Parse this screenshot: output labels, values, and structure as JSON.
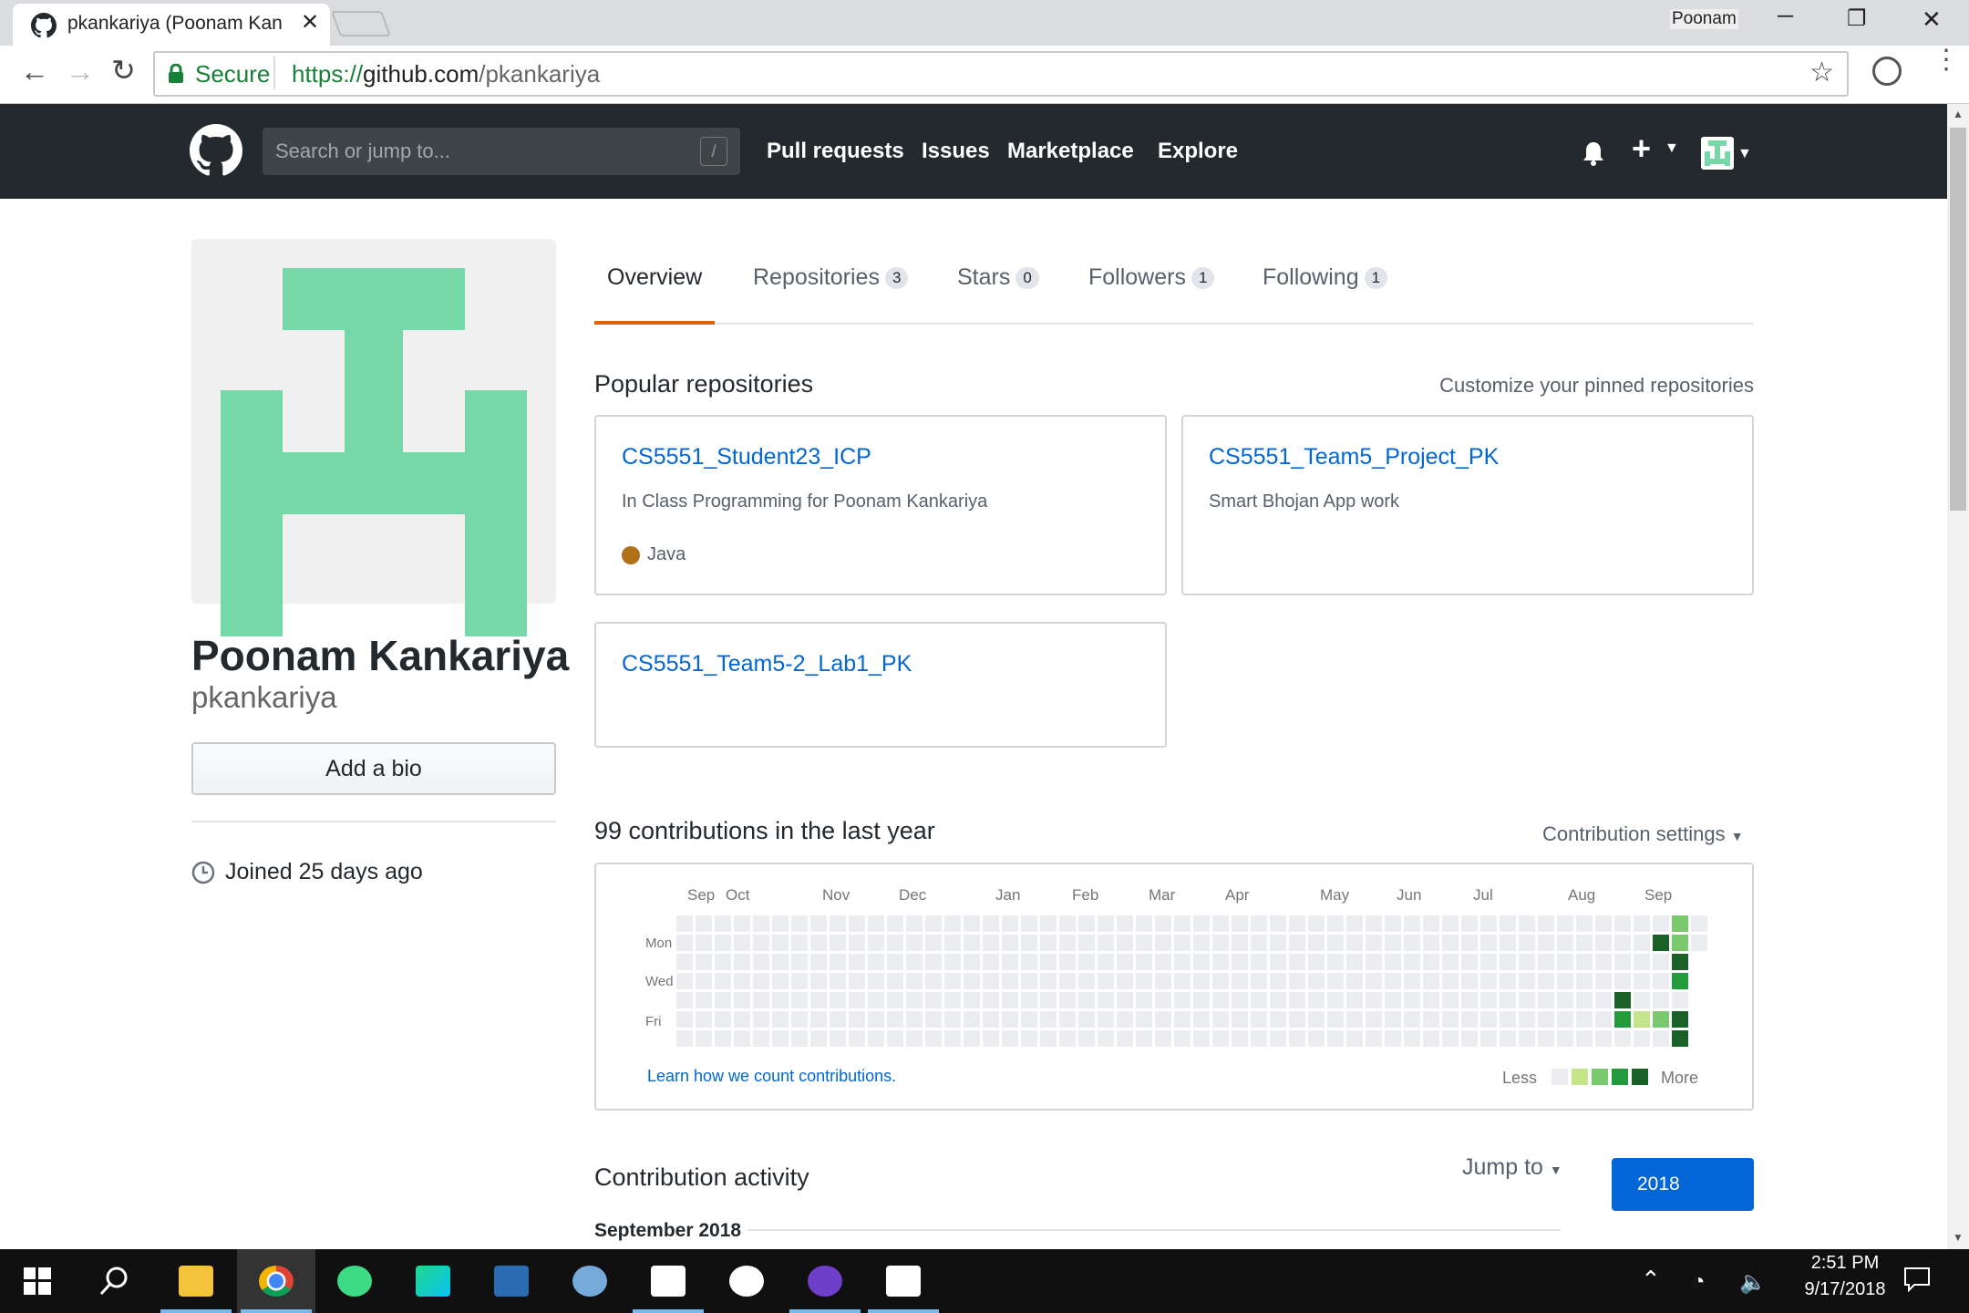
{
  "browser": {
    "tab_title": "pkankariya (Poonam Kan",
    "profile_name": "Poonam",
    "secure_label": "Secure",
    "url_scheme": "https://",
    "url_host": "github.com",
    "url_path": "/pkankariya"
  },
  "gh_header": {
    "search_placeholder": "Search or jump to...",
    "search_shortcut": "/",
    "nav": [
      "Pull requests",
      "Issues",
      "Marketplace",
      "Explore"
    ]
  },
  "profile": {
    "full_name": "Poonam Kankariya",
    "username": "pkankariya",
    "bio_button": "Add a bio",
    "joined": "Joined 25 days ago"
  },
  "tabs": [
    {
      "label": "Overview",
      "count": null
    },
    {
      "label": "Repositories",
      "count": "3"
    },
    {
      "label": "Stars",
      "count": "0"
    },
    {
      "label": "Followers",
      "count": "1"
    },
    {
      "label": "Following",
      "count": "1"
    }
  ],
  "popular": {
    "heading": "Popular repositories",
    "customize": "Customize your pinned repositories",
    "repos": [
      {
        "name": "CS5551_Student23_ICP",
        "desc": "In Class Programming for Poonam Kankariya",
        "lang": "Java"
      },
      {
        "name": "CS5551_Team5_Project_PK",
        "desc": "Smart Bhojan App work",
        "lang": ""
      },
      {
        "name": "CS5551_Team5-2_Lab1_PK",
        "desc": "",
        "lang": ""
      }
    ]
  },
  "contributions": {
    "heading": "99 contributions in the last year",
    "settings": "Contribution settings",
    "months": [
      "Sep",
      "Oct",
      "Nov",
      "Dec",
      "Jan",
      "Feb",
      "Mar",
      "Apr",
      "May",
      "Jun",
      "Jul",
      "Aug",
      "Sep"
    ],
    "days": [
      "Mon",
      "Wed",
      "Fri"
    ],
    "learn_link": "Learn how we count contributions.",
    "less": "Less",
    "more": "More",
    "colors": [
      "#ebedf0",
      "#c6e48b",
      "#7bc96f",
      "#239a3b",
      "#196127"
    ]
  },
  "activity": {
    "heading": "Contribution activity",
    "jump_to": "Jump to",
    "year": "2018",
    "month": "September 2018"
  },
  "taskbar": {
    "time": "2:51 PM",
    "date": "9/17/2018"
  }
}
